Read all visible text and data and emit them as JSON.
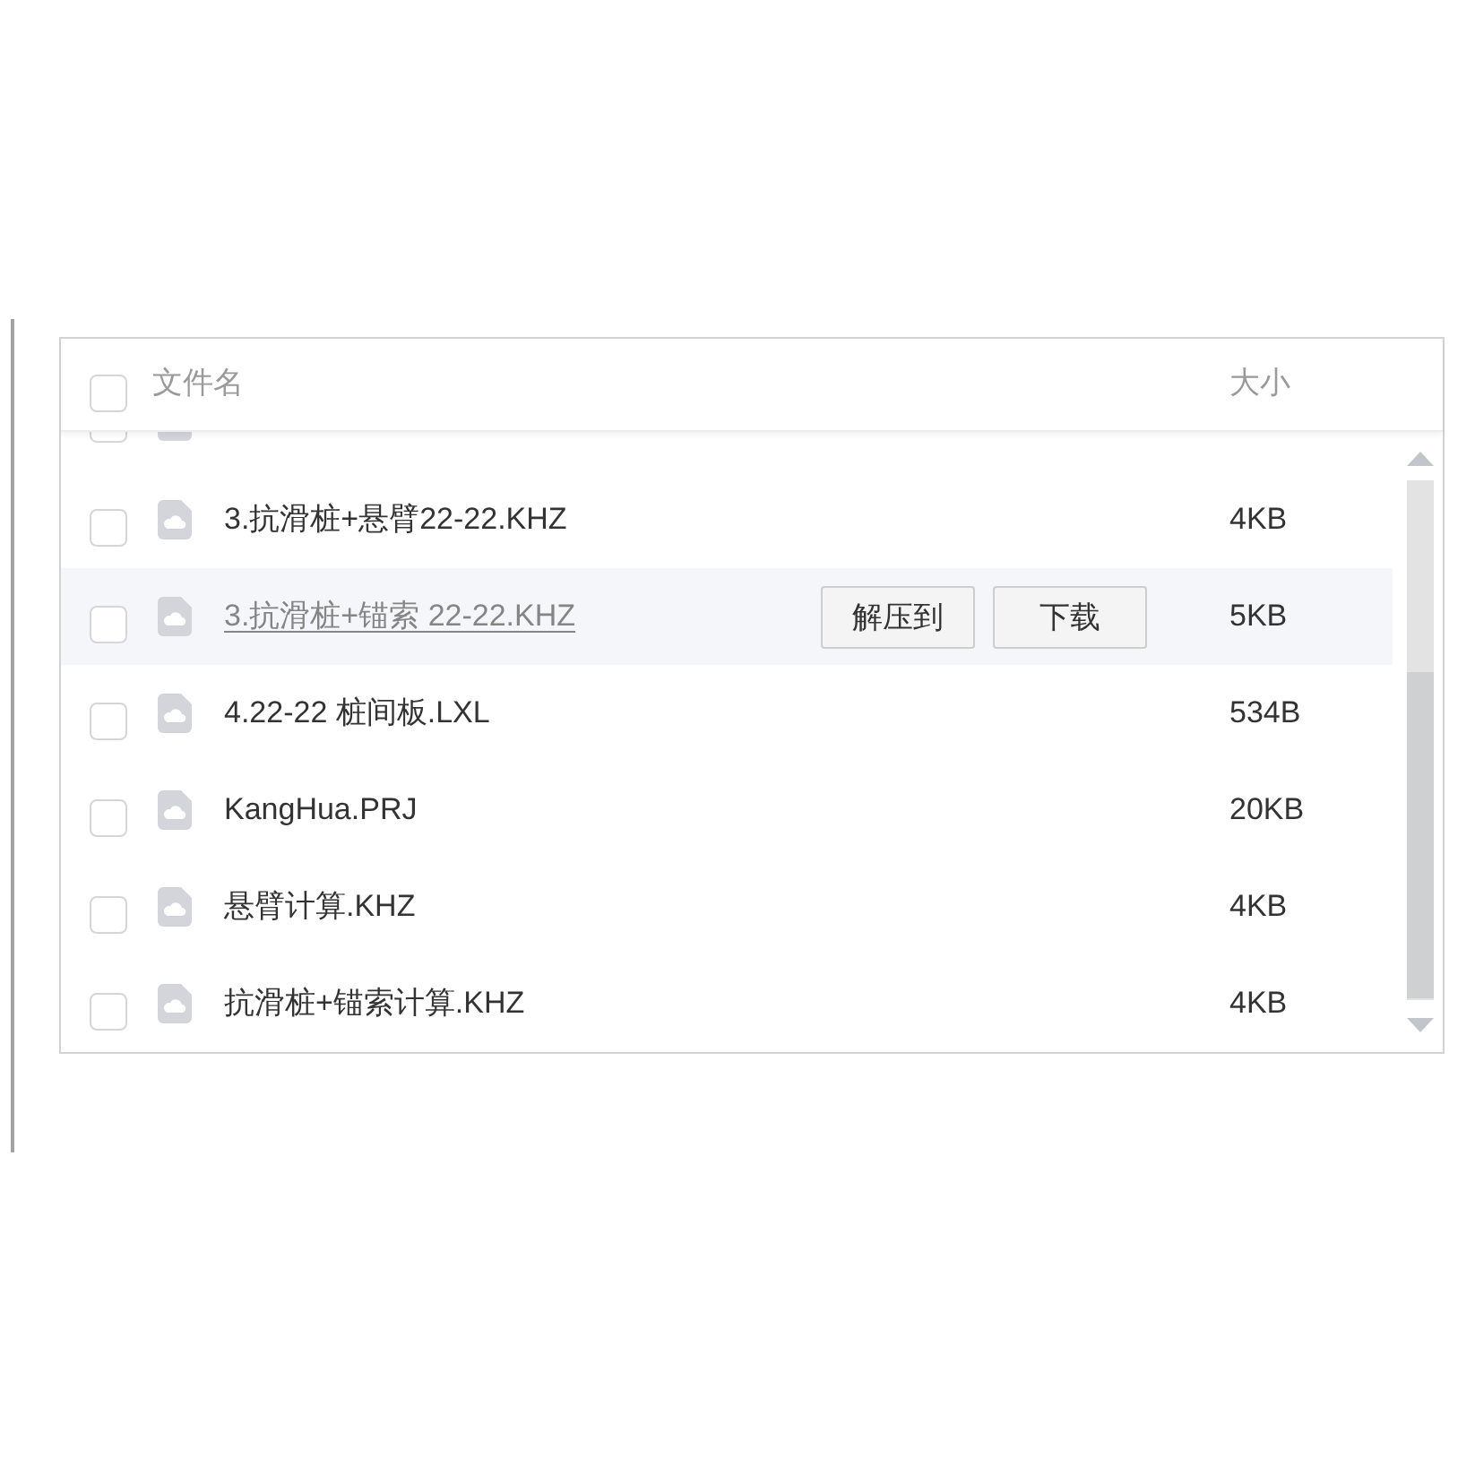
{
  "header": {
    "checked": false,
    "columns": [
      "文件名",
      "大小"
    ]
  },
  "rows": [
    {
      "clipped": true,
      "checked": false,
      "hovered": false
    },
    {
      "clipped": false,
      "checked": false,
      "hovered": false,
      "name": "3.抗滑桩+悬臂22-22.KHZ",
      "size": "4KB"
    },
    {
      "clipped": false,
      "checked": false,
      "hovered": true,
      "name": "3.抗滑桩+锚索 22-22.KHZ",
      "size": "5KB",
      "actions": [
        "解压到",
        "下载"
      ]
    },
    {
      "clipped": false,
      "checked": false,
      "hovered": false,
      "name": "4.22-22 桩间板.LXL",
      "size": "534B"
    },
    {
      "clipped": false,
      "checked": false,
      "hovered": false,
      "name": "KangHua.PRJ",
      "size": "20KB"
    },
    {
      "clipped": false,
      "checked": false,
      "hovered": false,
      "name": "悬臂计算.KHZ",
      "size": "4KB"
    },
    {
      "clipped": false,
      "checked": false,
      "hovered": false,
      "name": "抗滑桩+锚索计算.KHZ",
      "size": "4KB"
    }
  ]
}
